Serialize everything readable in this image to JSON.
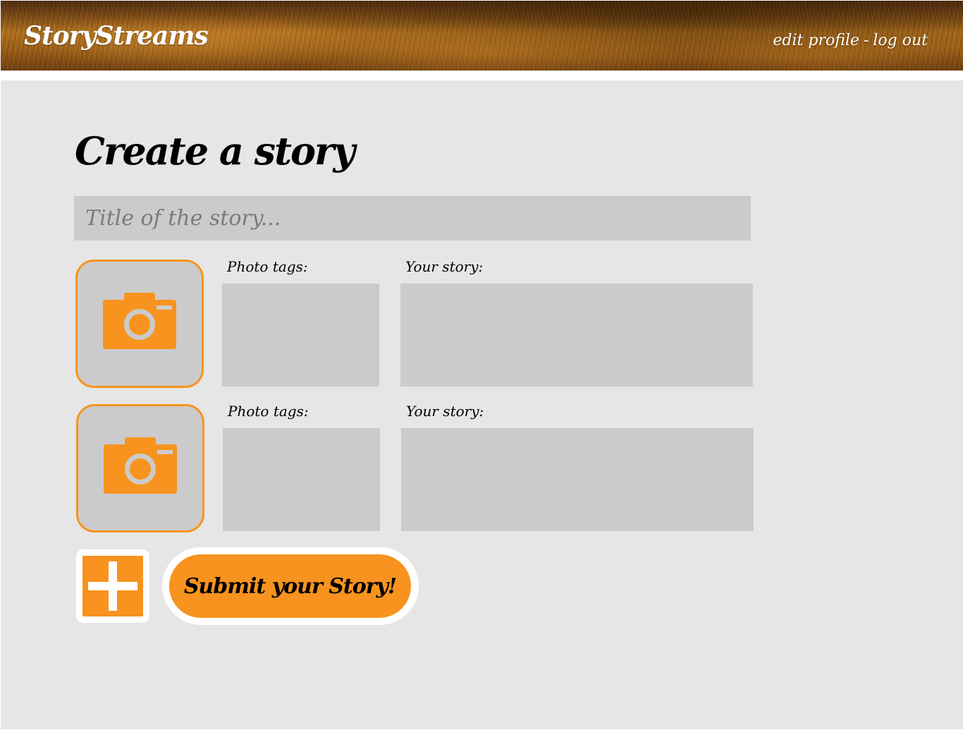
{
  "header": {
    "brand": "StoryStreams",
    "nav": {
      "edit_profile": "edit profile",
      "separator": "-",
      "log_out": "log out"
    }
  },
  "main": {
    "title": "Create a story",
    "title_input": {
      "placeholder": "Title of the story...",
      "value": ""
    },
    "entries": [
      {
        "photo_icon": "camera-icon",
        "tags_label": "Photo tags:",
        "story_label": "Your story:",
        "tags_value": "",
        "story_value": ""
      },
      {
        "photo_icon": "camera-icon",
        "tags_label": "Photo tags:",
        "story_label": "Your story:",
        "tags_value": "",
        "story_value": ""
      }
    ],
    "add_button_icon": "plus-icon",
    "submit_label": "Submit your Story!"
  },
  "colors": {
    "accent": "#f7931e",
    "panel": "#e6e6e6",
    "field": "#cbcbcb",
    "text": "#000000"
  }
}
